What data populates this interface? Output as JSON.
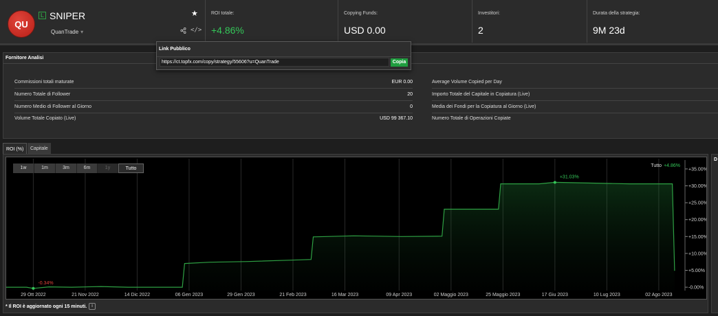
{
  "header": {
    "avatar_initials": "QU",
    "badge": "L",
    "strategy_name": "SNIPER",
    "provider": "QuanTrade",
    "provider_caret": "▾",
    "star_icon": "★",
    "code_icon": "</>",
    "stats": [
      {
        "label": "ROI totale:",
        "value": "+4.86%",
        "color": "#34c759"
      },
      {
        "label": "Copying Funds:",
        "value": "USD 0.00"
      },
      {
        "label": "Investitori:",
        "value": "2"
      },
      {
        "label": "Durata della strategia:",
        "value": "9M 23d"
      }
    ]
  },
  "popup": {
    "title": "Link Pubblico",
    "url": "https://ct.topfx.com/copy/strategy/55606?u=QuanTrade",
    "copy_label": "Copia"
  },
  "analysis": {
    "title": "Fornitore Analisi",
    "left_rows": [
      {
        "k": "Commissioni totali maturate",
        "v": "EUR 0.00"
      },
      {
        "k": "Numero Totale di Follower",
        "v": "20"
      },
      {
        "k": "Numero Medio di Follower al Giorno",
        "v": "0"
      },
      {
        "k": "Volume Totale Copiato (Live)",
        "v": "USD 99 367.10"
      }
    ],
    "right_rows": [
      {
        "k": "Average Volume Copied per Day",
        "v": ""
      },
      {
        "k": "Importo Totale del Capitale in Copiatura (Live)",
        "v": ""
      },
      {
        "k": "Media dei Fondi per la Copiatura al Giorno (Live)",
        "v": ""
      },
      {
        "k": "Numero Totale di Operazioni Copiate",
        "v": ""
      }
    ]
  },
  "chart_tabs": [
    "ROI (%)",
    "Capitale"
  ],
  "range_buttons": [
    "1w",
    "1m",
    "3m",
    "6m",
    "1y",
    "Tutto"
  ],
  "legend": {
    "label": "Tutto",
    "value": "+4.86%"
  },
  "right_panel_label": "D",
  "footnote": "* Il ROI è aggiornato ogni 15 minuti.",
  "info_icon": "i",
  "colors": {
    "accent": "#34c759",
    "negative": "#e0443a",
    "line": "#2ea043"
  },
  "chart_data": {
    "type": "line",
    "x_labels": [
      "29 Ott 2022",
      "21 Nov 2022",
      "14 Dic 2022",
      "06 Gen 2023",
      "29 Gen 2023",
      "21 Feb 2023",
      "16 Mar 2023",
      "09 Apr 2023",
      "02 Maggio 2023",
      "25 Maggio 2023",
      "17 Giu 2023",
      "10 Lug 2023",
      "02 Ago 2023"
    ],
    "y_ticks": [
      "0.00%",
      "5.00%",
      "10.00%",
      "15.00%",
      "20.00%",
      "25.00%",
      "30.00%",
      "35.00%"
    ],
    "ylim": [
      -1,
      36
    ],
    "x_start": "2022-10-17",
    "x_end": "2023-08-13",
    "points": [
      [
        "2022-10-17",
        0.0
      ],
      [
        "2022-10-26",
        0.0
      ],
      [
        "2022-10-29",
        -0.34
      ],
      [
        "2022-11-05",
        0.1
      ],
      [
        "2022-11-15",
        0.0
      ],
      [
        "2022-11-28",
        0.2
      ],
      [
        "2022-12-10",
        0.0
      ],
      [
        "2022-12-25",
        0.0
      ],
      [
        "2023-01-03",
        0.0
      ],
      [
        "2023-01-04",
        7.0
      ],
      [
        "2023-01-15",
        7.4
      ],
      [
        "2023-02-01",
        7.6
      ],
      [
        "2023-02-20",
        8.0
      ],
      [
        "2023-03-01",
        8.2
      ],
      [
        "2023-03-02",
        14.9
      ],
      [
        "2023-03-20",
        15.2
      ],
      [
        "2023-04-10",
        15.0
      ],
      [
        "2023-04-28",
        15.1
      ],
      [
        "2023-04-29",
        23.1
      ],
      [
        "2023-05-23",
        23.1
      ],
      [
        "2023-05-24",
        30.6
      ],
      [
        "2023-06-10",
        30.6
      ],
      [
        "2023-06-17",
        31.03
      ],
      [
        "2023-07-20",
        30.6
      ],
      [
        "2023-08-08",
        30.6
      ],
      [
        "2023-08-09",
        4.86
      ]
    ],
    "annotations": [
      {
        "date": "2022-10-29",
        "y": -0.34,
        "label": "-0.34%",
        "color": "#e0443a"
      },
      {
        "date": "2023-06-17",
        "y": 31.03,
        "label": "+31.03%",
        "color": "#34c759"
      }
    ]
  }
}
